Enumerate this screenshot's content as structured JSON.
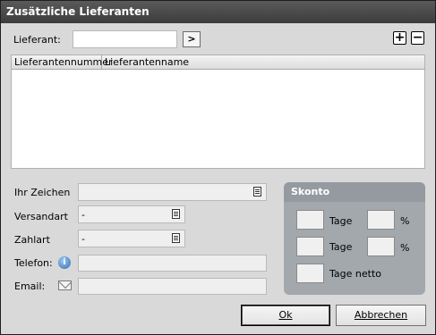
{
  "window": {
    "title": "Zusätzliche Lieferanten"
  },
  "lieferant": {
    "label": "Lieferant:",
    "value": "",
    "go_label": ">"
  },
  "toolbar": {
    "add_label": "+",
    "remove_label": "−"
  },
  "table": {
    "columns": [
      "Lieferantennummer",
      "Lieferantenname"
    ],
    "rows": []
  },
  "form": {
    "ihr_zeichen": {
      "label": "Ihr Zeichen",
      "value": ""
    },
    "versandart": {
      "label": "Versandart",
      "value": "-"
    },
    "zahlart": {
      "label": "Zahlart",
      "value": "-"
    },
    "telefon": {
      "label": "Telefon:",
      "value": ""
    },
    "email": {
      "label": "Email:",
      "value": ""
    }
  },
  "skonto": {
    "title": "Skonto",
    "row1": {
      "days": "",
      "percent": "",
      "days_label": "Tage",
      "percent_label": "%"
    },
    "row2": {
      "days": "",
      "percent": "",
      "days_label": "Tage",
      "percent_label": "%"
    },
    "row3": {
      "days": "",
      "days_label": "Tage netto"
    }
  },
  "buttons": {
    "ok_label": "Ok",
    "cancel_label": "Abbrechen"
  },
  "icons": {
    "picker": "document-list-icon",
    "telefon": "info-phone-icon",
    "email": "envelope-icon"
  }
}
